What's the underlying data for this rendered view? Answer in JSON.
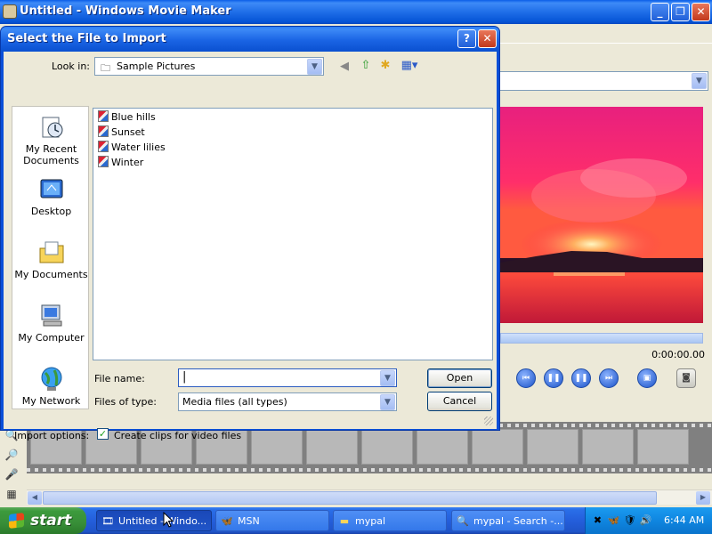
{
  "main_window": {
    "title": "Untitled - Windows Movie Maker",
    "controls": {
      "minimize": "_",
      "maximize": "❐",
      "close": "✕"
    },
    "preview": {
      "timecode": "0:00:00.00"
    }
  },
  "dialog": {
    "title": "Select the File to Import",
    "help_label": "?",
    "close_label": "✕",
    "look_in_label": "Look in:",
    "look_in_value": "Sample Pictures",
    "places": [
      {
        "label": "My Recent Documents",
        "icon": "recent-documents-icon"
      },
      {
        "label": "Desktop",
        "icon": "desktop-icon"
      },
      {
        "label": "My Documents",
        "icon": "my-documents-icon"
      },
      {
        "label": "My Computer",
        "icon": "my-computer-icon"
      },
      {
        "label": "My Network",
        "icon": "my-network-icon"
      }
    ],
    "files": [
      "Blue hills",
      "Sunset",
      "Water lilies",
      "Winter"
    ],
    "file_name_label": "File name:",
    "file_name_value": "",
    "files_of_type_label": "Files of type:",
    "files_of_type_value": "Media files (all types)",
    "open_label": "Open",
    "cancel_label": "Cancel",
    "import_options_label": "Import options:",
    "create_clips_label": "Create clips for video files",
    "create_clips_checked": true
  },
  "taskbar": {
    "start_label": "start",
    "tasks": [
      {
        "label": "Untitled - Windo...",
        "icon": "movie-maker-icon",
        "active": true
      },
      {
        "label": "MSN",
        "icon": "msn-icon",
        "active": false
      },
      {
        "label": "mypal",
        "icon": "folder-icon",
        "active": false
      },
      {
        "label": "mypal - Search -...",
        "icon": "search-icon",
        "active": false
      }
    ],
    "clock": "6:44 AM"
  },
  "colors": {
    "title_blue": "#0a5ee8",
    "start_green": "#3c9a3c",
    "dialog_bg": "#ece9d8"
  }
}
